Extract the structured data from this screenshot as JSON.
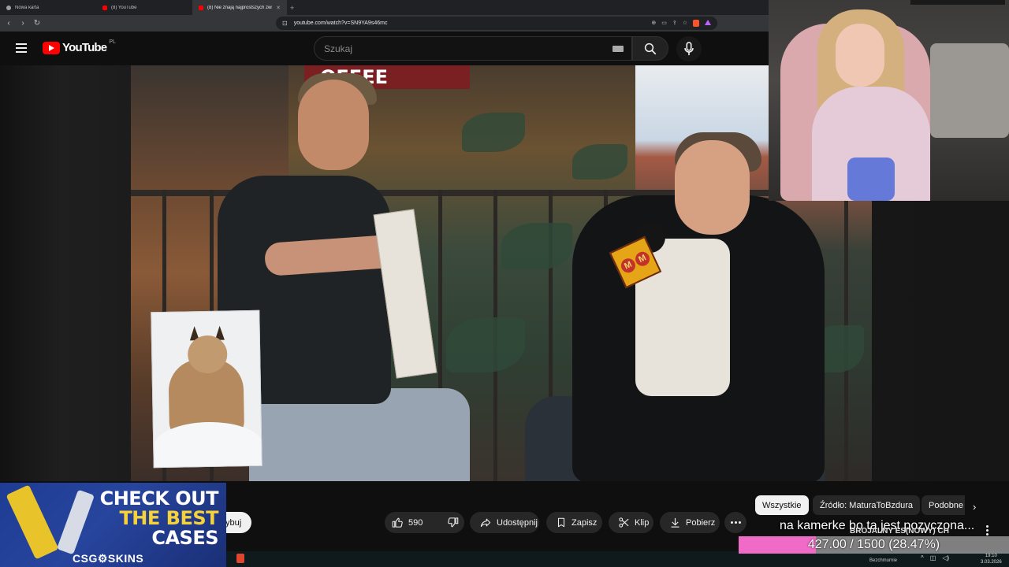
{
  "browser": {
    "tabs": [
      {
        "label": "Nowa karta",
        "active": false
      },
      {
        "label": "(8) YouTube",
        "active": false
      },
      {
        "label": "(8) Nie znają najprostszych zwi",
        "active": true
      }
    ],
    "url": "youtube.com/watch?v=SN9YA9s46mc"
  },
  "youtube": {
    "logo_text": "YouTube",
    "country_code": "PL",
    "search_placeholder": "Szukaj"
  },
  "video": {
    "banner_text": "OFFEE"
  },
  "actions": {
    "subscribe_fragment": "ybuj",
    "like_count": "590",
    "share_label": "Udostępnij",
    "save_label": "Zapisz",
    "clip_label": "Klip",
    "download_label": "Pobierz"
  },
  "chips": [
    {
      "label": "Wszystkie",
      "active": true
    },
    {
      "label": "Źródło: MaturaToBzdura",
      "active": false
    },
    {
      "label": "Podobne",
      "active": false
    }
  ],
  "overlays": {
    "ad": {
      "line1": "CHECK OUT",
      "line2": "THE BEST",
      "line3": "CASES",
      "brand": "CSG⚙SKINS"
    },
    "tts_text": "na kamerke bo ta jest pozyczona...",
    "goal_label": "BROJALNY ES(NOWY) CH",
    "goal_text": "427.00 / 1500 (28.47%)",
    "goal_progress": 0.2847
  },
  "taskbar": {
    "user": "Bezchmurnie",
    "time": "19:10",
    "date": "3.03.2026"
  },
  "colors": {
    "yt_red": "#ff0000",
    "goal_pink": "#f06ac8",
    "ad_blue": "#1e3c94",
    "ad_yellow": "#f7d13a"
  }
}
